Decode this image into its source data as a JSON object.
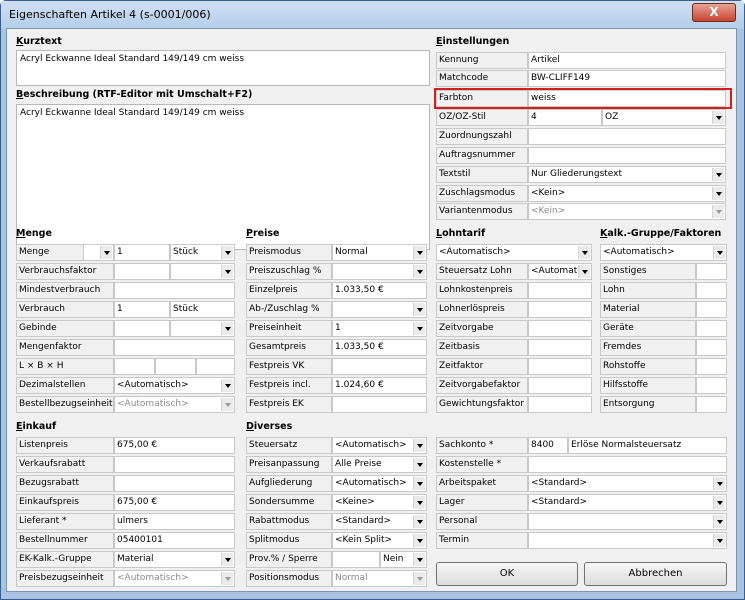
{
  "window": {
    "title": "Eigenschaften Artikel 4 (s-0001/006)",
    "close_glyph": "X"
  },
  "kurztext": {
    "header": "Kurztext",
    "value": "Acryl Eckwanne Ideal Standard 149/149 cm weiss"
  },
  "beschreibung": {
    "header": "Beschreibung (RTF-Editor mit Umschalt+F2)",
    "value": "Acryl Eckwanne Ideal Standard 149/149 cm weiss"
  },
  "einstellungen": {
    "header": "Einstellungen",
    "rows": [
      {
        "label": "Kennung",
        "value": "Artikel"
      },
      {
        "label": "Matchcode",
        "value": "BW-CLIFF149"
      },
      {
        "label": "Farbton",
        "value": "weiss"
      },
      {
        "label": "OZ/OZ-Stil",
        "value": "4",
        "value2": "OZ"
      },
      {
        "label": "Zuordnungszahl",
        "value": ""
      },
      {
        "label": "Auftragsnummer",
        "value": ""
      },
      {
        "label": "Textstil",
        "value": "Nur Gliederungstext"
      },
      {
        "label": "Zuschlagsmodus",
        "value": "<Kein>"
      },
      {
        "label": "Variantenmodus",
        "value": "<Kein>"
      }
    ]
  },
  "menge": {
    "header": "Menge",
    "rows": [
      {
        "label": "Menge",
        "value": "1",
        "unit": "Stück"
      },
      {
        "label": "Verbrauchsfaktor",
        "value": ""
      },
      {
        "label": "Mindestverbrauch",
        "value": ""
      },
      {
        "label": "Verbrauch",
        "value": "1",
        "unit": "Stück"
      },
      {
        "label": "Gebinde",
        "value": ""
      },
      {
        "label": "Mengenfaktor",
        "value": ""
      },
      {
        "label": "L × B × H",
        "value": ""
      },
      {
        "label": "Dezimalstellen",
        "value": "<Automatisch>"
      },
      {
        "label": "Bestellbezugseinheit",
        "value": "<Automatisch>"
      }
    ]
  },
  "preise": {
    "header": "Preise",
    "rows": [
      {
        "label": "Preismodus",
        "value": "Normal"
      },
      {
        "label": "Preiszuschlag %",
        "value": ""
      },
      {
        "label": "Einzelpreis",
        "value": "1.033,50 €"
      },
      {
        "label": "Ab-/Zuschlag %",
        "value": ""
      },
      {
        "label": "Preiseinheit",
        "value": "1"
      },
      {
        "label": "Gesamtpreis",
        "value": "1.033,50 €"
      },
      {
        "label": "Festpreis VK",
        "value": ""
      },
      {
        "label": "Festpreis incl.",
        "value": "1.024,60 €"
      },
      {
        "label": "Festpreis EK",
        "value": ""
      }
    ]
  },
  "lohntarif": {
    "header": "Lohntarif",
    "combo": "<Automatisch>",
    "rows": [
      {
        "label": "Steuersatz Lohn",
        "value": "<Automat"
      },
      {
        "label": "Lohnkostenpreis",
        "value": ""
      },
      {
        "label": "Lohnerlöspreis",
        "value": ""
      },
      {
        "label": "Zeitvorgabe",
        "value": ""
      },
      {
        "label": "Zeitbasis",
        "value": ""
      },
      {
        "label": "Zeitfaktor",
        "value": ""
      },
      {
        "label": "Zeitvorgabefaktor",
        "value": ""
      },
      {
        "label": "Gewichtungsfaktor",
        "value": ""
      }
    ]
  },
  "kalk": {
    "header": "Kalk.-Gruppe/Faktoren",
    "combo": "<Automatisch>",
    "rows": [
      {
        "label": "Sonstiges"
      },
      {
        "label": "Lohn"
      },
      {
        "label": "Material"
      },
      {
        "label": "Geräte"
      },
      {
        "label": "Fremdes"
      },
      {
        "label": "Rohstoffe"
      },
      {
        "label": "Hilfsstoffe"
      },
      {
        "label": "Entsorgung"
      }
    ]
  },
  "einkauf": {
    "header": "Einkauf",
    "rows": [
      {
        "label": "Listenpreis",
        "value": "675,00 €"
      },
      {
        "label": "Verkaufsrabatt",
        "value": ""
      },
      {
        "label": "Bezugsrabatt",
        "value": ""
      },
      {
        "label": "Einkaufspreis",
        "value": "675,00 €"
      },
      {
        "label": "Lieferant *",
        "value": "ulmers"
      },
      {
        "label": "Bestellnummer",
        "value": "05400101"
      },
      {
        "label": "EK-Kalk.-Gruppe",
        "value": "Material"
      },
      {
        "label": "Preisbezugseinheit",
        "value": "<Automatisch>"
      }
    ]
  },
  "diverses": {
    "header": "Diverses",
    "rows": [
      {
        "label": "Steuersatz",
        "value": "<Automatisch>"
      },
      {
        "label": "Preisanpassung",
        "value": "Alle Preise"
      },
      {
        "label": "Aufgliederung",
        "value": "<Automatisch>"
      },
      {
        "label": "Sondersumme",
        "value": "<Keine>"
      },
      {
        "label": "Rabattmodus",
        "value": "<Standard>"
      },
      {
        "label": "Splitmodus",
        "value": "<Kein Split>"
      },
      {
        "label": "Prov.% / Sperre",
        "value": "",
        "value2": "Nein"
      },
      {
        "label": "Positionsmodus",
        "value": "Normal"
      }
    ]
  },
  "konten": {
    "rows": [
      {
        "label": "Sachkonto *",
        "value": "8400",
        "value2": "Erlöse Normalsteuersatz"
      },
      {
        "label": "Kostenstelle *",
        "value": ""
      },
      {
        "label": "Arbeitspaket",
        "value": "<Standard>"
      },
      {
        "label": "Lager",
        "value": "<Standard>"
      },
      {
        "label": "Personal",
        "value": ""
      },
      {
        "label": "Termin",
        "value": ""
      }
    ]
  },
  "buttons": {
    "ok": "OK",
    "cancel": "Abbrechen"
  }
}
